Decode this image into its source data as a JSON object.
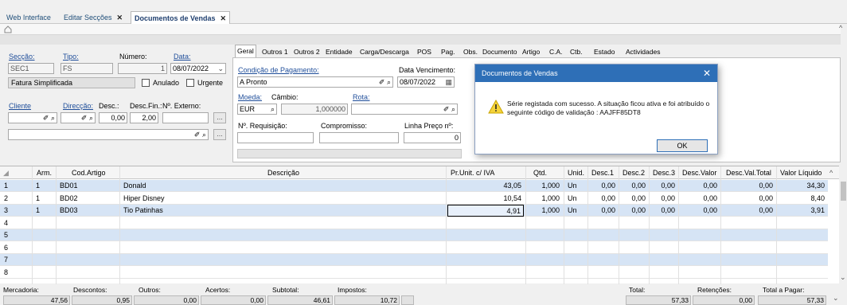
{
  "tabs": [
    {
      "label": "Web Interface"
    },
    {
      "label": "Editar Secções",
      "close": "✕"
    },
    {
      "label": "Documentos de Vendas",
      "close": "✕"
    }
  ],
  "header": {
    "seccao_label": "Secção:",
    "seccao": "SEC1",
    "tipo_label": "Tipo:",
    "tipo": "FS",
    "numero_label": "Número:",
    "numero": "1",
    "data_label": "Data:",
    "data": "08/07/2022",
    "tipo_desc": "Fatura Simplificada",
    "anulado": "Anulado",
    "urgente": "Urgente",
    "cliente_label": "Cliente",
    "direccao_label": "Direcção:",
    "desc_label": "Desc.:",
    "desc_fin_label": "Desc.Fin.:",
    "n_externo_label": "Nº. Externo:",
    "desc": "0,00",
    "desc_fin": "2,00",
    "ellipsis": "...",
    "marker": "✐ ⌕"
  },
  "inner_tabs": [
    "Geral",
    "Outros 1",
    "Outros 2",
    "Entidade",
    "Carga/Descarga",
    "POS",
    "Pag.",
    "Obs.",
    "Documento",
    "Artigo",
    "C.A.",
    "Ctb.",
    "Estado",
    "Actividades"
  ],
  "geral": {
    "cond_pag_label": "Condição de Pagamento:",
    "cond_pag": "A Pronto",
    "data_venc_label": "Data Vencimento:",
    "data_venc": "08/07/2022",
    "moeda_label": "Moeda:",
    "cambio_label": "Câmbio:",
    "rota_label": "Rota:",
    "moeda": "EUR",
    "cambio": "1,000000",
    "n_req_label": "Nº. Requisição:",
    "compromisso_label": "Compromisso:",
    "linha_preco_label": "Linha Preço nº:",
    "linha_preco": "0"
  },
  "grid": {
    "columns": [
      "Arm.",
      "Cod.Artigo",
      "Descrição",
      "Pr.Unit. c/ IVA",
      "Qtd.",
      "Unid.",
      "Desc.1",
      "Desc.2",
      "Desc.3",
      "Desc.Valor",
      "Desc.Val.Total",
      "Valor Líquido"
    ],
    "rows": [
      {
        "n": "1",
        "arm": "1",
        "cod": "BD01",
        "desc": "Donald",
        "pr": "43,05",
        "qtd": "1,000",
        "unid": "Un",
        "d1": "0,00",
        "d2": "0,00",
        "d3": "0,00",
        "dv": "0,00",
        "dvt": "0,00",
        "vl": "34,30"
      },
      {
        "n": "2",
        "arm": "1",
        "cod": "BD02",
        "desc": "Hiper Disney",
        "pr": "10,54",
        "qtd": "1,000",
        "unid": "Un",
        "d1": "0,00",
        "d2": "0,00",
        "d3": "0,00",
        "dv": "0,00",
        "dvt": "0,00",
        "vl": "8,40"
      },
      {
        "n": "3",
        "arm": "1",
        "cod": "BD03",
        "desc": "Tio Patinhas",
        "pr": "4,91",
        "qtd": "1,000",
        "unid": "Un",
        "d1": "0,00",
        "d2": "0,00",
        "d3": "0,00",
        "dv": "0,00",
        "dvt": "0,00",
        "vl": "3,91"
      },
      {
        "n": "4"
      },
      {
        "n": "5"
      },
      {
        "n": "6"
      },
      {
        "n": "7"
      },
      {
        "n": "8"
      }
    ]
  },
  "footer": {
    "mercadoria_label": "Mercadoria:",
    "mercadoria": "47,56",
    "descontos_label": "Descontos:",
    "descontos": "0,95",
    "outros_label": "Outros:",
    "outros": "0,00",
    "acertos_label": "Acertos:",
    "acertos": "0,00",
    "subtotal_label": "Subtotal:",
    "subtotal": "46,61",
    "impostos_label": "Impostos:",
    "impostos": "10,72",
    "total_label": "Total:",
    "total": "57,33",
    "retencoes_label": "Retenções:",
    "retencoes": "0,00",
    "total_pagar_label": "Total a Pagar:",
    "total_pagar": "57,33"
  },
  "dialog": {
    "title": "Documentos de Vendas",
    "close": "✕",
    "message": "Série registada com sucesso. A situação ficou ativa e foi atribuído o seguinte código de validação : AAJFF85DT8",
    "ok": "OK"
  },
  "colors": {
    "accent": "#2e6fb7",
    "row_alt": "#d6e4f5",
    "link": "#1f4e9a"
  }
}
